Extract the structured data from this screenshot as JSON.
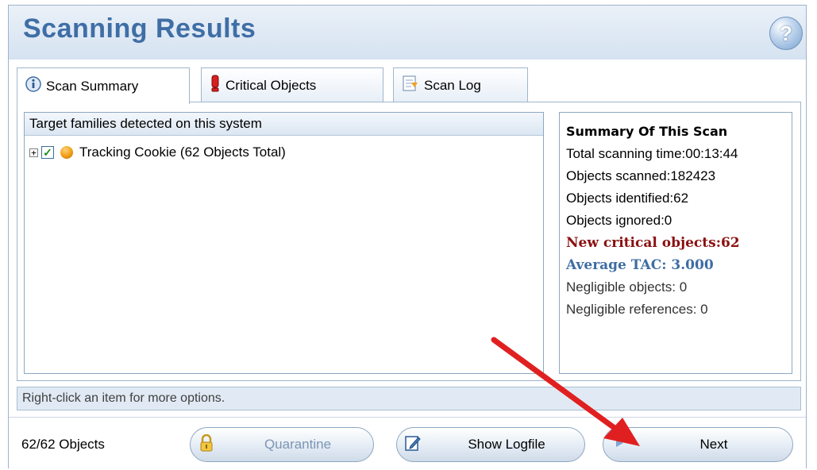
{
  "header": {
    "title": "Scanning Results",
    "help_icon": "question-mark-icon",
    "help_glyph": "?"
  },
  "tabs": [
    {
      "label": "Scan Summary",
      "icon": "info-icon",
      "active": true
    },
    {
      "label": "Critical Objects",
      "icon": "alert-icon",
      "active": false
    },
    {
      "label": "Scan Log",
      "icon": "log-icon",
      "active": false
    }
  ],
  "list": {
    "header": "Target families detected on this system",
    "items": [
      {
        "expander": "+",
        "checked": true,
        "check_glyph": "✓",
        "icon": "orange-ball-icon",
        "label": "Tracking Cookie (62 Objects Total)"
      }
    ]
  },
  "summary": {
    "heading": "Summary Of This Scan",
    "total_time": "Total scanning time:00:13:44",
    "objects_scanned": "Objects scanned:182423",
    "objects_identified": "Objects identified:62",
    "objects_ignored": "Objects ignored:0",
    "new_critical": "New critical objects:62",
    "average_tac": "Average TAC: 3.000",
    "negligible_objects": "Negligible objects: 0",
    "negligible_references": "Negligible references: 0"
  },
  "hint": "Right-click an item for more options.",
  "footer": {
    "count": "62/62 Objects",
    "quarantine_label": "Quarantine",
    "show_logfile_label": "Show Logfile",
    "next_label": "Next"
  },
  "colors": {
    "accent": "#3f6ea6",
    "critical": "#8b1010",
    "annotation_arrow": "#e02020"
  }
}
